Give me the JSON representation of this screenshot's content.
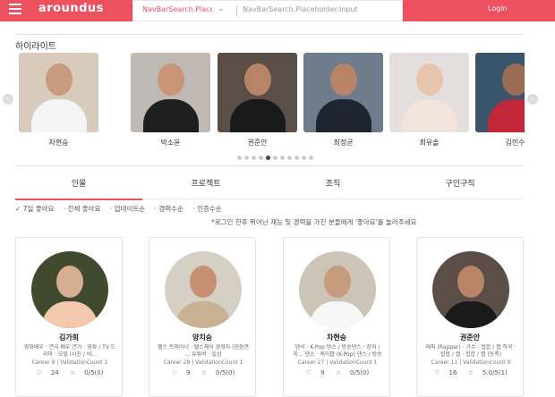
{
  "nav": {
    "logo": "aroundus",
    "search_placeholder_1": "NavBarSearch.Placehol...",
    "search_placeholder_2": "NavBarSearch.Placeholder.Input",
    "login": "Login",
    "brand_color": "#ec5160"
  },
  "highlights": {
    "title": "하이라이트",
    "items": [
      {
        "name": "차현승"
      },
      {
        "name": "박소윤"
      },
      {
        "name": "권준안"
      },
      {
        "name": "최정균"
      },
      {
        "name": "최유솔"
      },
      {
        "name": "김민수"
      }
    ],
    "page_count": 11,
    "active_page": 4
  },
  "tabs": [
    "인물",
    "프로젝트",
    "조직",
    "구인구직"
  ],
  "active_tab": 0,
  "filters": [
    "✓ 7일 좋아요",
    "· 전체 좋아요",
    "· 업데이트순",
    "· 경력수순",
    "· 인증수순"
  ],
  "notice": "*로그인 한후 뛰어난 재능 및 경력을 가진 분들에게 '좋아요'를 눌러주세요",
  "people": [
    {
      "name": "김가희",
      "desc": "영화배우 · 연극 배우 연기 · 영화 / TV 드라마 · 모델 (사진 / 비...",
      "career": "Career 9 | ValidationCount 1",
      "likes": "24",
      "rating": "0/5(0)"
    },
    {
      "name": "양치승",
      "desc": "헬스 트레이너 · 헬스체어 경영자 (헌장관 ... 유튜버 · 일상",
      "career": "Career 28 | ValidationCount 1",
      "likes": "9",
      "rating": "0/5(0)"
    },
    {
      "name": "차현승",
      "desc": "댄서 · K-Pop 댄스 / 방송댄스 · 창의 / 지... 댄스 · 케이팝 (K-Pop) 댄스 / 방송댄스 · ...",
      "career": "Career 27 | ValidationCount 1",
      "likes": "9",
      "rating": "0/5(0)"
    },
    {
      "name": "권준안",
      "desc": "래퍼 (Rapper) · 가수 · 힙합 / 랩 작곡 · 힙합 / 랩 · 힙합 / 랩 (등록)",
      "career": "Career 11 | ValidationCount 0",
      "likes": "16",
      "rating": "5.0/5(1)"
    }
  ]
}
